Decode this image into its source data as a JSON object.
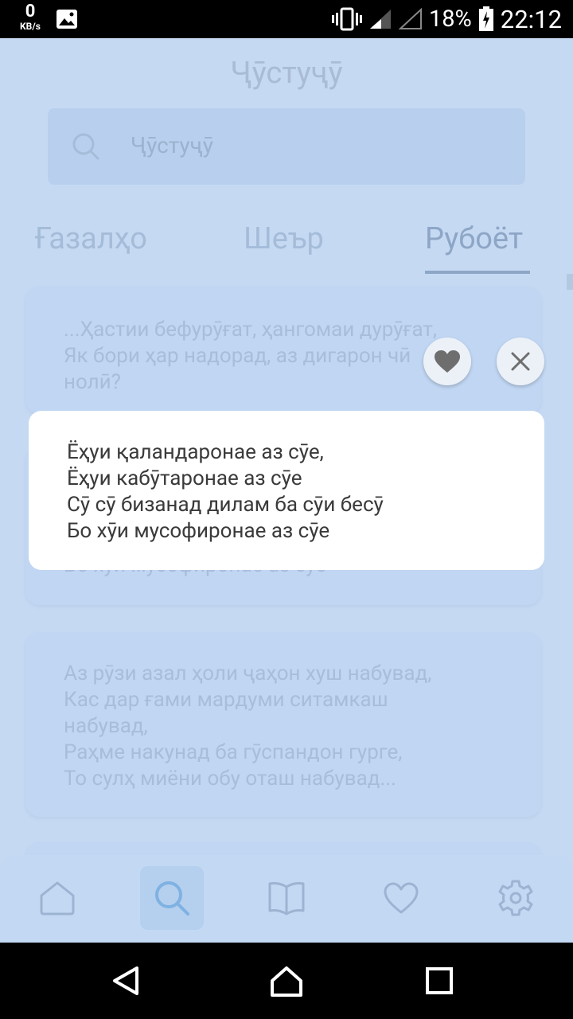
{
  "status_bar": {
    "net_speed_value": "0",
    "net_speed_unit": "KB/s",
    "battery_percent": "18%",
    "time": "22:12"
  },
  "header": {
    "title": "Ҷӯстуҷӯ",
    "search_placeholder": "Ҷӯстуҷӯ"
  },
  "tabs": [
    "Ғазалҳо",
    "Шеър",
    "Рубоёт"
  ],
  "cards": [
    {
      "lines": [
        "...Ҳастии бефурӯғат, ҳангомаи дурӯғат,",
        "Як бори ҳар надорад, аз дигарон чӣ",
        "нолӣ?"
      ]
    },
    {
      "lines": [
        "Бо хӯи мусофиронае аз сӯе"
      ]
    },
    {
      "lines": [
        "Аз  рӯзи  азал ҳоли ҷаҳон хуш  набувад,",
        "Кас  дар  ғами мардуми  ситамкаш",
        "набувад,",
        "Раҳме накунад ба  гӯспандон  гурге,",
        "То сулҳ  миёни  обу оташ набувад..."
      ]
    }
  ],
  "modal": {
    "lines": [
      "Ёҳуи қаландаронае аз сӯе,",
      "Ёҳуи кабӯтаронае аз сӯе",
      "Сӯ сӯ бизанад дилам ба сӯи бесӯ",
      "Бо хӯи мусофиронае аз сӯе"
    ]
  },
  "bottom_nav": [
    "home-icon",
    "search-icon",
    "book-icon",
    "heart-icon",
    "gear-icon"
  ],
  "colors": {
    "background": "#c5d9f3",
    "modal": "#ffffff",
    "accent": "#8fa7c7"
  }
}
